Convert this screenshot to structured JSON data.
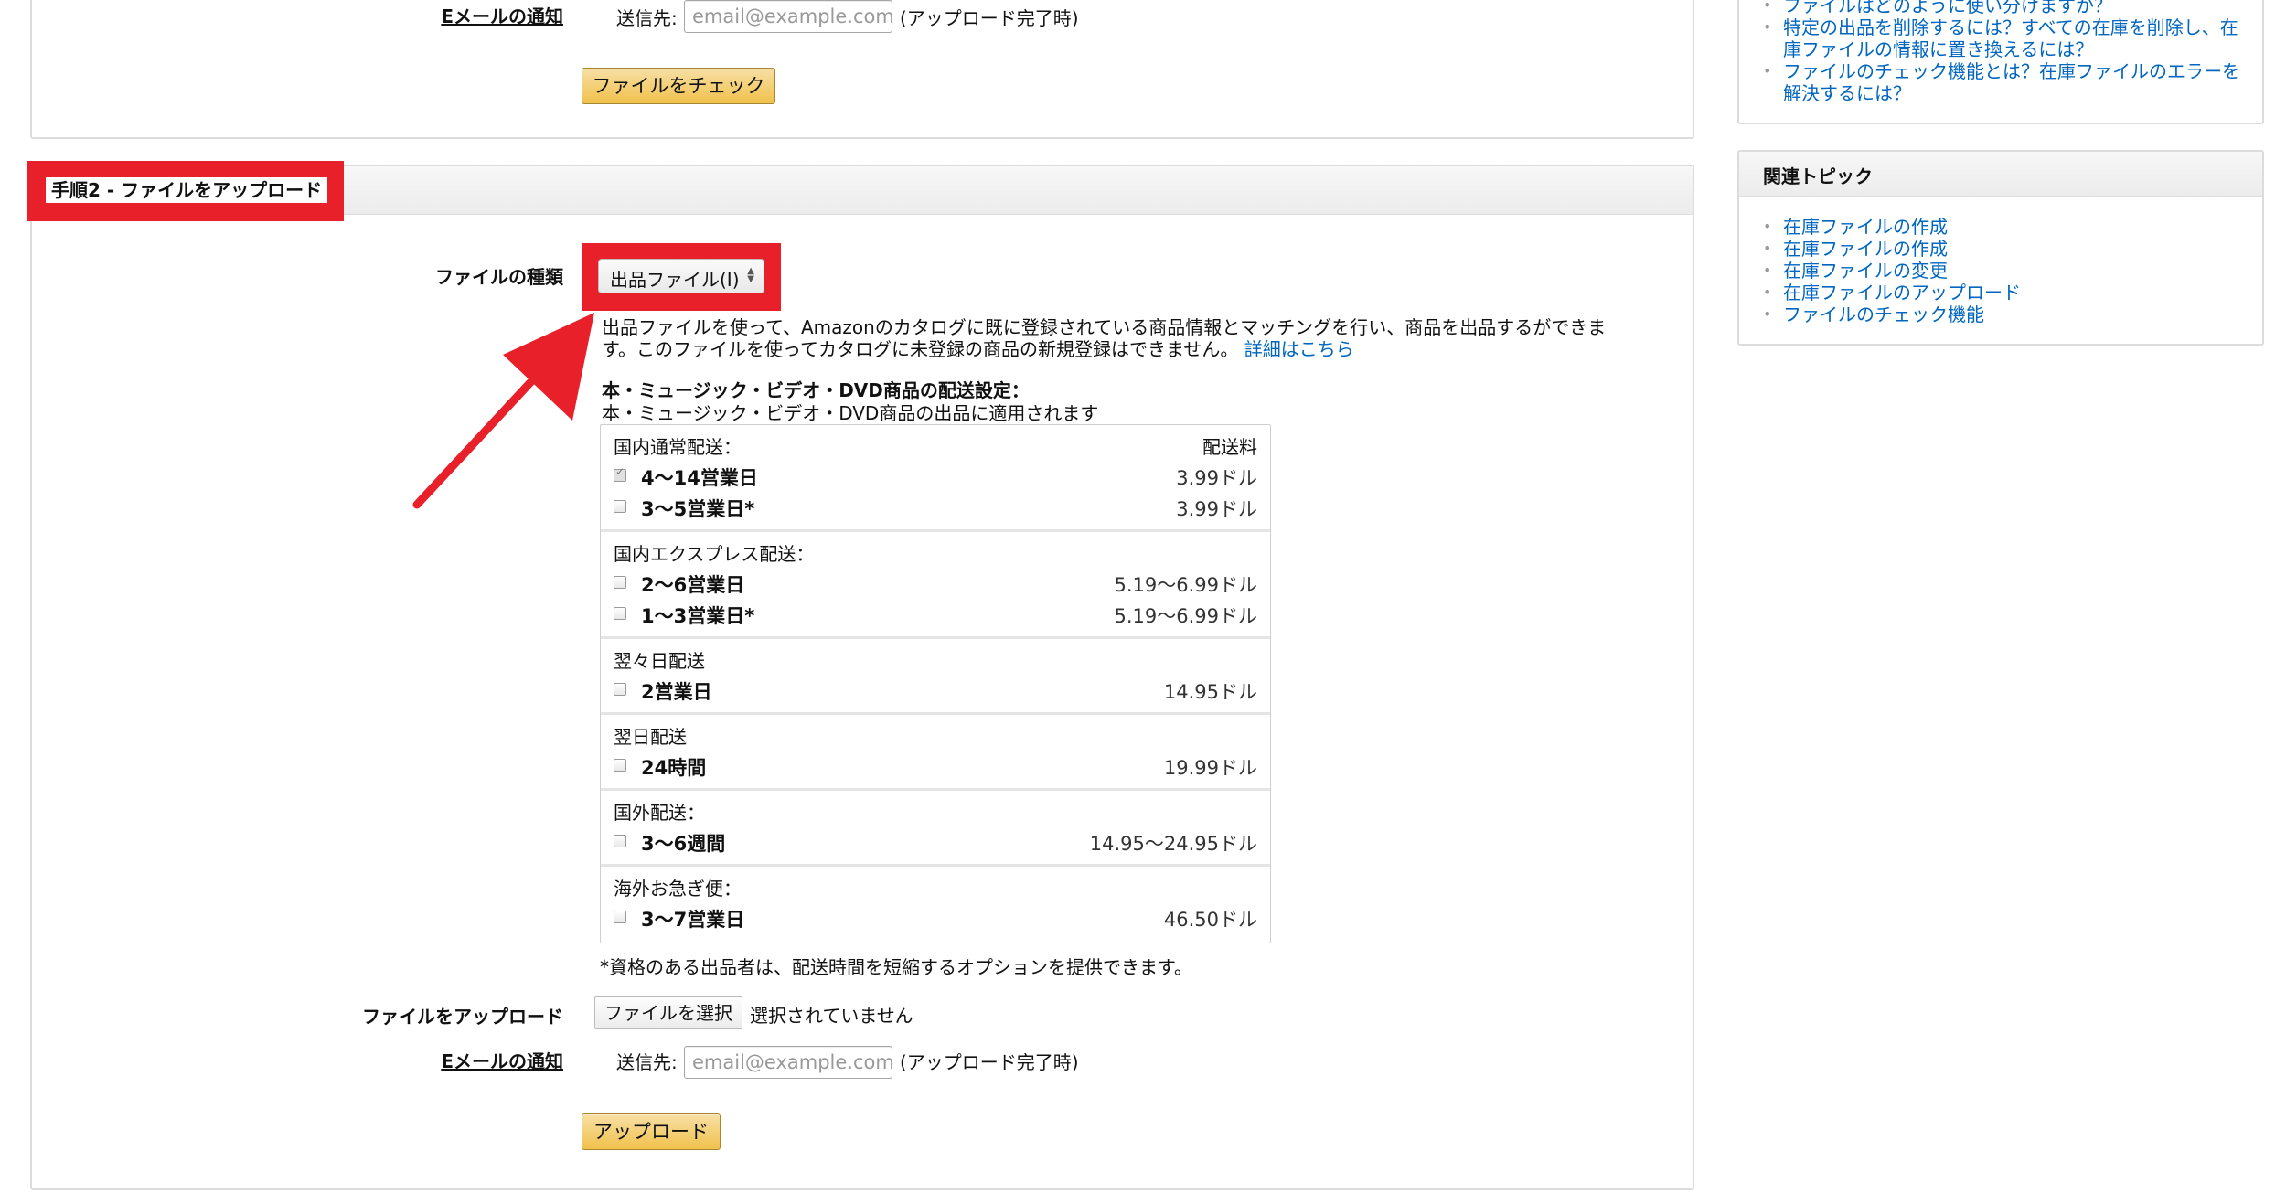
{
  "step1": {
    "email_label": "Eメールの通知",
    "send_to": "送信先:",
    "email_placeholder": "email@example.com",
    "email_suffix": "(アップロード完了時)",
    "check_button": "ファイルをチェック"
  },
  "step2": {
    "header": "手順2 - ファイルをアップロード",
    "file_type_label": "ファイルの種類",
    "file_type_value": "出品ファイル(I)",
    "description": "出品ファイルを使って、Amazonのカタログに既に登録されている商品情報とマッチングを行い、商品を出品するができます。このファイルを使ってカタログに未登録の商品の新規登録はできません。",
    "details_link": "詳細はこちら",
    "shipping_title": "本・ミュージック・ビデオ・DVD商品の配送設定：",
    "shipping_subtitle": "本・ミュージック・ビデオ・DVD商品の出品に適用されます",
    "fee_header": "配送料",
    "shipping_sections": [
      {
        "title": "国内通常配送：",
        "rows": [
          {
            "name": "4〜14営業日",
            "price": "3.99ドル",
            "checked": true
          },
          {
            "name": "3〜5営業日*",
            "price": "3.99ドル",
            "checked": false
          }
        ]
      },
      {
        "title": "国内エクスプレス配送：",
        "rows": [
          {
            "name": "2〜6営業日",
            "price": "5.19〜6.99ドル",
            "checked": false
          },
          {
            "name": "1〜3営業日*",
            "price": "5.19〜6.99ドル",
            "checked": false
          }
        ]
      },
      {
        "title": "翌々日配送",
        "rows": [
          {
            "name": "2営業日",
            "price": "14.95ドル",
            "checked": false
          }
        ]
      },
      {
        "title": "翌日配送",
        "rows": [
          {
            "name": "24時間",
            "price": "19.99ドル",
            "checked": false
          }
        ]
      },
      {
        "title": "国外配送：",
        "rows": [
          {
            "name": "3〜6週間",
            "price": "14.95〜24.95ドル",
            "checked": false
          }
        ]
      },
      {
        "title": "海外お急ぎ便：",
        "rows": [
          {
            "name": "3〜7営業日",
            "price": "46.50ドル",
            "checked": false
          }
        ]
      }
    ],
    "footnote": "*資格のある出品者は、配送時間を短縮するオプションを提供できます。",
    "upload_label": "ファイルをアップロード",
    "choose_file_button": "ファイルを選択",
    "no_file_text": "選択されていません",
    "email_label": "Eメールの通知",
    "send_to": "送信先:",
    "email_placeholder": "email@example.com",
    "email_suffix": "(アップロード完了時)",
    "upload_button": "アップロード"
  },
  "sidebar": {
    "faq_links": [
      "ファイルはどのように使い分けますか？",
      "特定の出品を削除するには？すべての在庫を削除し、在庫ファイルの情報に置き換えるには？",
      "ファイルのチェック機能とは？在庫ファイルのエラーを解決するには？"
    ],
    "related_title": "関連トピック",
    "related_links": [
      "在庫ファイルの作成",
      "在庫ファイルの作成",
      "在庫ファイルの変更",
      "在庫ファイルのアップロード",
      "ファイルのチェック機能"
    ]
  },
  "colors": {
    "highlight": "#e8202a",
    "link": "#0066c0",
    "button": "#f0c14b"
  }
}
